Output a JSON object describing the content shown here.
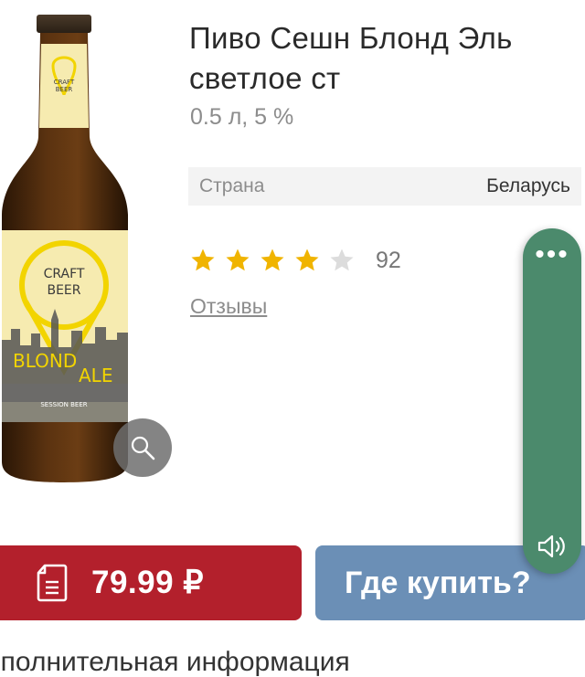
{
  "product": {
    "title": "Пиво Сешн Блонд Эль светлое ст",
    "subtitle": "0.5 л, 5 %",
    "image_label": {
      "brand_line1": "CRAFT",
      "brand_line2": "BEER",
      "name": "BLOND ALE",
      "name_part1": "BLOND",
      "name_part2": "ALE",
      "tagline": "SESSION BEER"
    }
  },
  "specs": [
    {
      "label": "Страна",
      "value": "Беларусь"
    }
  ],
  "rating": {
    "stars": 4,
    "max_stars": 5,
    "count": "92",
    "reviews_link": "Отзывы"
  },
  "actions": {
    "price": "79.99 ₽",
    "where_to_buy": "Где купить?"
  },
  "section_heading": "ополнительная информация",
  "side_panel": {
    "more_icon": "more-dots-icon",
    "speaker_icon": "speaker-icon"
  },
  "colors": {
    "price_button": "#b3202c",
    "where_button": "#6b8fb6",
    "side_panel": "#4b8a6c",
    "star_filled": "#f0b400",
    "star_empty": "#dcdcdc",
    "spec_bg": "#f3f3f3"
  }
}
